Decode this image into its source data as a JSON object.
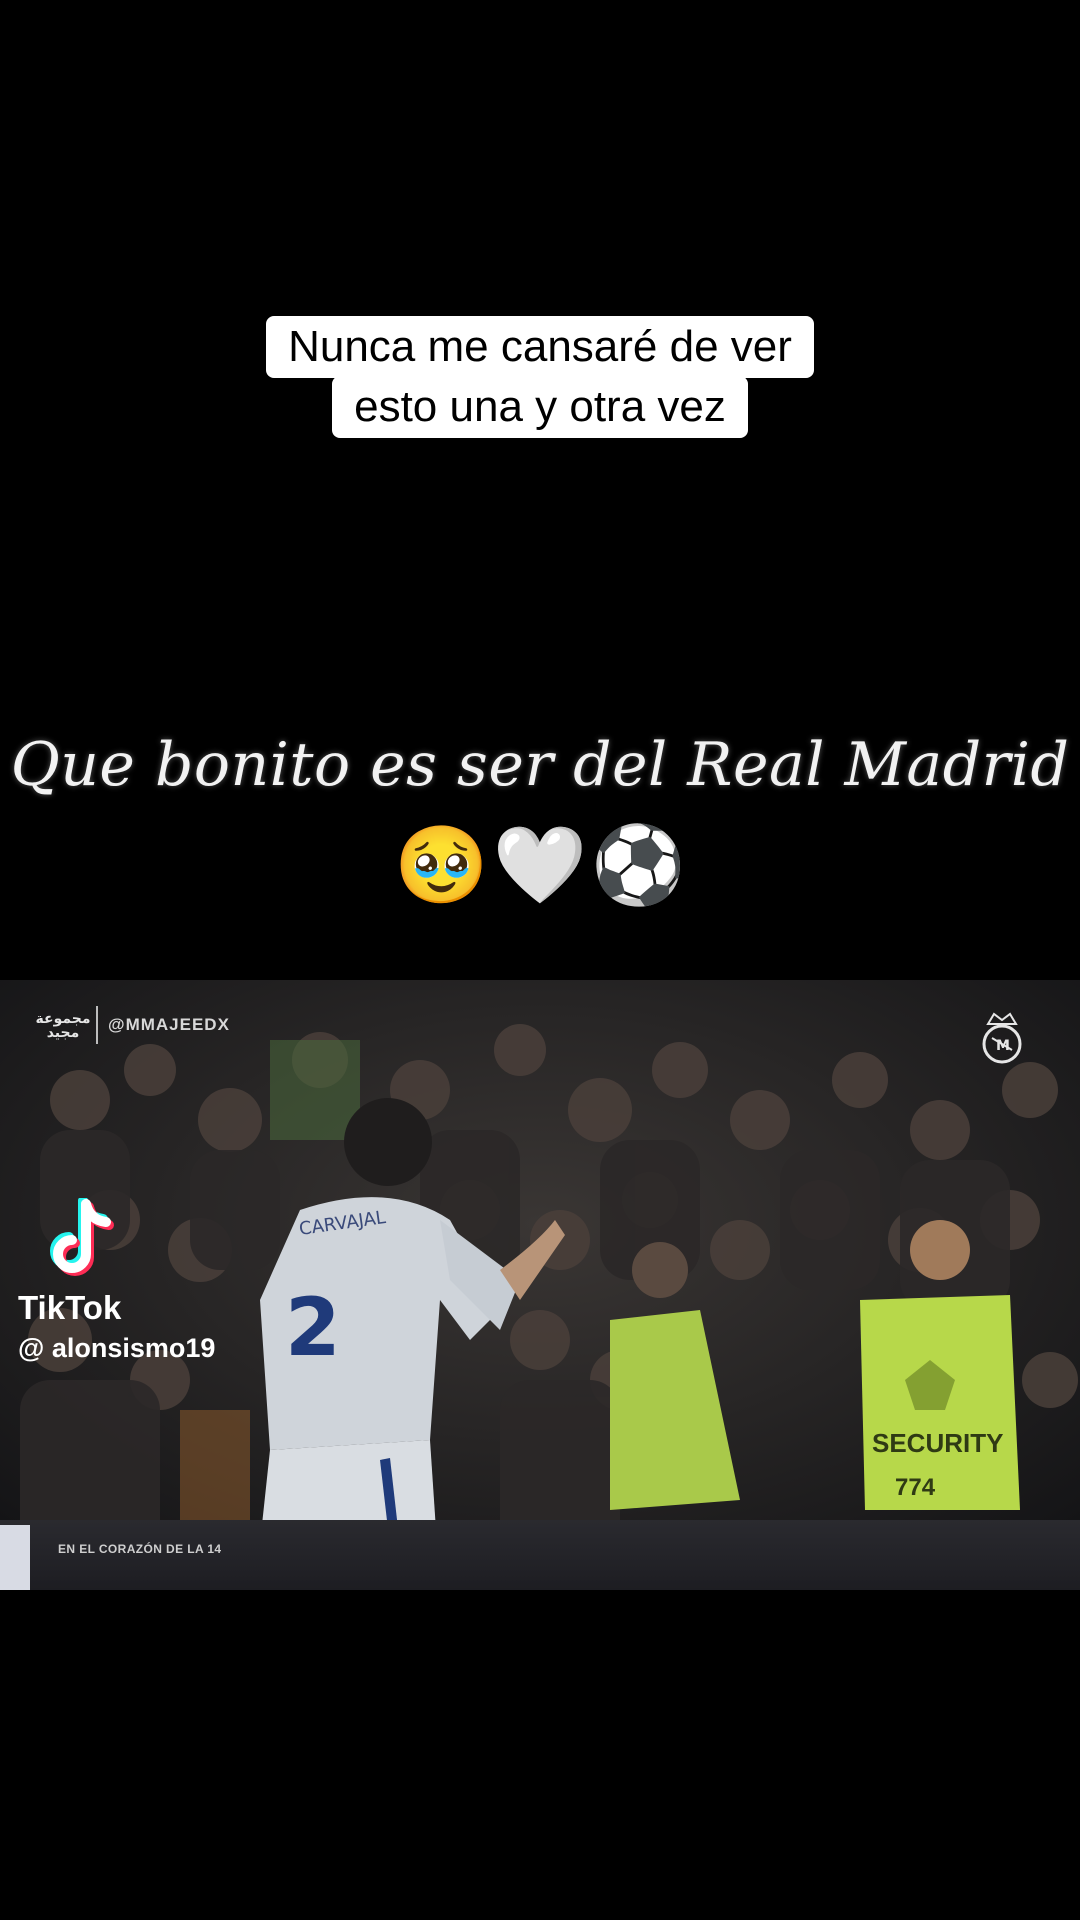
{
  "caption": {
    "line1": "Nunca me cansaré de ver",
    "line2": "esto una y otra vez"
  },
  "video_title": "Que bonito es ser del Real Madrid",
  "emojis": {
    "face": "🥹",
    "heart": "🤍",
    "ball": "⚽"
  },
  "video": {
    "channel_handle": "@MMAJEEDX",
    "channel_logo_text_top": "مجموعة",
    "channel_logo_text_bottom": "مجيد",
    "lower_third": "EN EL CORAZÓN DE LA 14",
    "jersey_name": "CARVAJAL",
    "jersey_number": "2",
    "security_vest_text": "SECURITY",
    "security_vest_number": "774"
  },
  "watermark": {
    "app_name": "TikTok",
    "username": "@ alonsismo19"
  },
  "colors": {
    "background": "#000000",
    "caption_bg": "#ffffff",
    "caption_text": "#000000",
    "tiktok_cyan": "#25f4ee",
    "tiktok_pink": "#fe2c55",
    "vest_green": "#b7d84a"
  }
}
